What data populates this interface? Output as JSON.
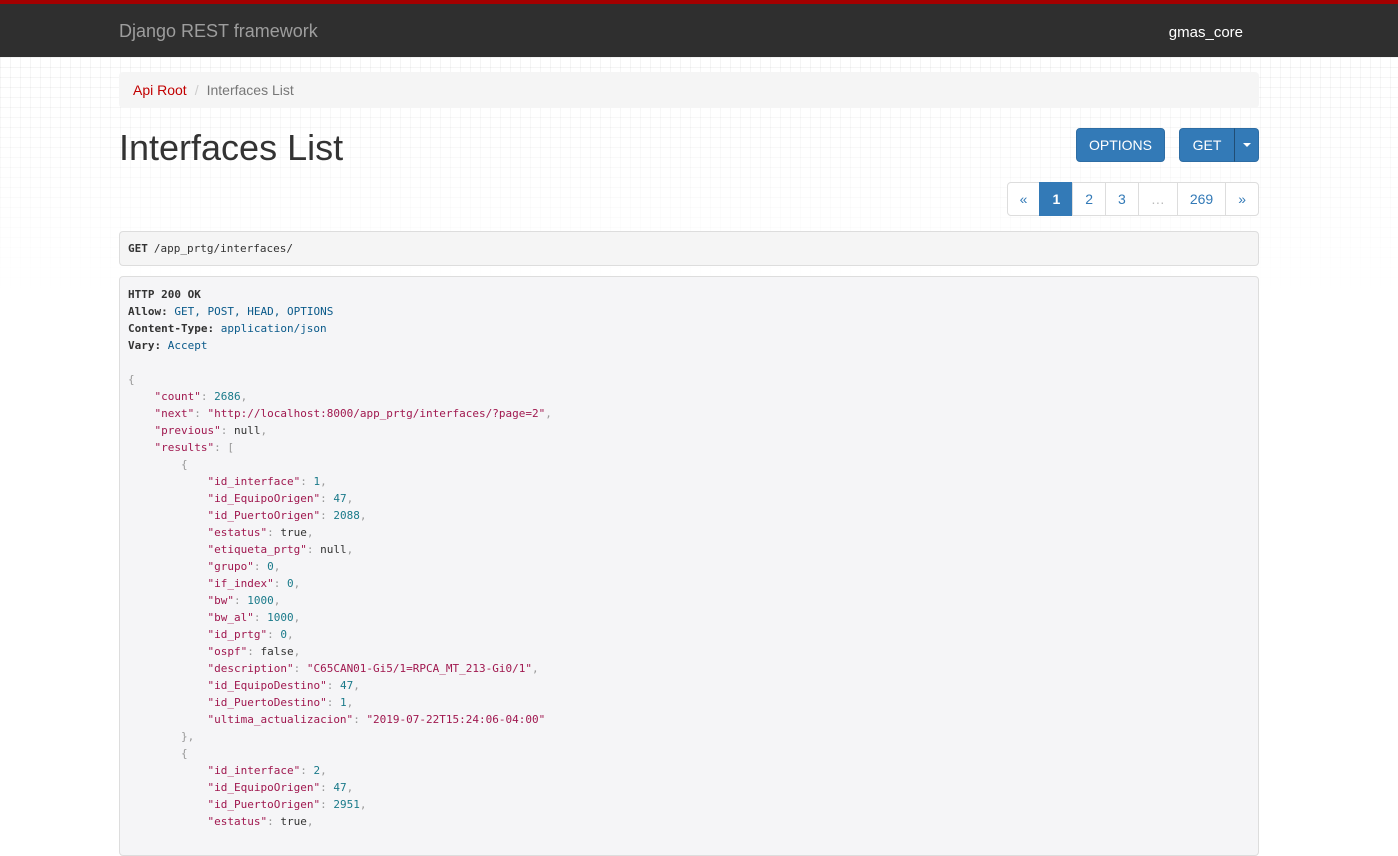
{
  "navbar": {
    "brand": "Django REST framework",
    "user": "gmas_core"
  },
  "breadcrumb": {
    "root": "Api Root",
    "separator": "/",
    "current": "Interfaces List"
  },
  "page": {
    "title": "Interfaces List"
  },
  "buttons": {
    "options": "OPTIONS",
    "get": "GET"
  },
  "pagination": {
    "prev": "«",
    "next": "»",
    "pages": [
      "1",
      "2",
      "3",
      "…",
      "269"
    ],
    "active": "1"
  },
  "request": {
    "method": "GET",
    "path": "/app_prtg/interfaces/"
  },
  "response": {
    "status": "HTTP 200 OK",
    "headers": [
      {
        "name": "Allow:",
        "value": "GET, POST, HEAD, OPTIONS"
      },
      {
        "name": "Content-Type:",
        "value": "application/json"
      },
      {
        "name": "Vary:",
        "value": "Accept"
      }
    ],
    "count_key": "\"count\"",
    "count": "2686",
    "next_key": "\"next\"",
    "next": "\"http://localhost:8000/app_prtg/interfaces/?page=2\"",
    "previous_key": "\"previous\"",
    "previous": "null",
    "results_key": "\"results\"",
    "results": [
      [
        {
          "k": "\"id_interface\"",
          "v": "1",
          "t": "num"
        },
        {
          "k": "\"id_EquipoOrigen\"",
          "v": "47",
          "t": "num"
        },
        {
          "k": "\"id_PuertoOrigen\"",
          "v": "2088",
          "t": "num"
        },
        {
          "k": "\"estatus\"",
          "v": "true",
          "t": "lit"
        },
        {
          "k": "\"etiqueta_prtg\"",
          "v": "null",
          "t": "lit"
        },
        {
          "k": "\"grupo\"",
          "v": "0",
          "t": "num"
        },
        {
          "k": "\"if_index\"",
          "v": "0",
          "t": "num"
        },
        {
          "k": "\"bw\"",
          "v": "1000",
          "t": "num"
        },
        {
          "k": "\"bw_al\"",
          "v": "1000",
          "t": "num"
        },
        {
          "k": "\"id_prtg\"",
          "v": "0",
          "t": "num"
        },
        {
          "k": "\"ospf\"",
          "v": "false",
          "t": "lit"
        },
        {
          "k": "\"description\"",
          "v": "\"C65CAN01-Gi5/1=RPCA_MT_213-Gi0/1\"",
          "t": "str"
        },
        {
          "k": "\"id_EquipoDestino\"",
          "v": "47",
          "t": "num"
        },
        {
          "k": "\"id_PuertoDestino\"",
          "v": "1",
          "t": "num"
        },
        {
          "k": "\"ultima_actualizacion\"",
          "v": "\"2019-07-22T15:24:06-04:00\"",
          "t": "str"
        }
      ],
      [
        {
          "k": "\"id_interface\"",
          "v": "2",
          "t": "num"
        },
        {
          "k": "\"id_EquipoOrigen\"",
          "v": "47",
          "t": "num"
        },
        {
          "k": "\"id_PuertoOrigen\"",
          "v": "2951",
          "t": "num"
        },
        {
          "k": "\"estatus\"",
          "v": "true",
          "t": "lit"
        }
      ]
    ]
  },
  "colors": {
    "navbar_bg": "#2f2f2f",
    "navbar_accent": "#a30000",
    "button_primary": "#337ab7",
    "breadcrumb_link": "#c20000",
    "json_key": "#a0184f",
    "json_number": "#1a7a8a"
  }
}
